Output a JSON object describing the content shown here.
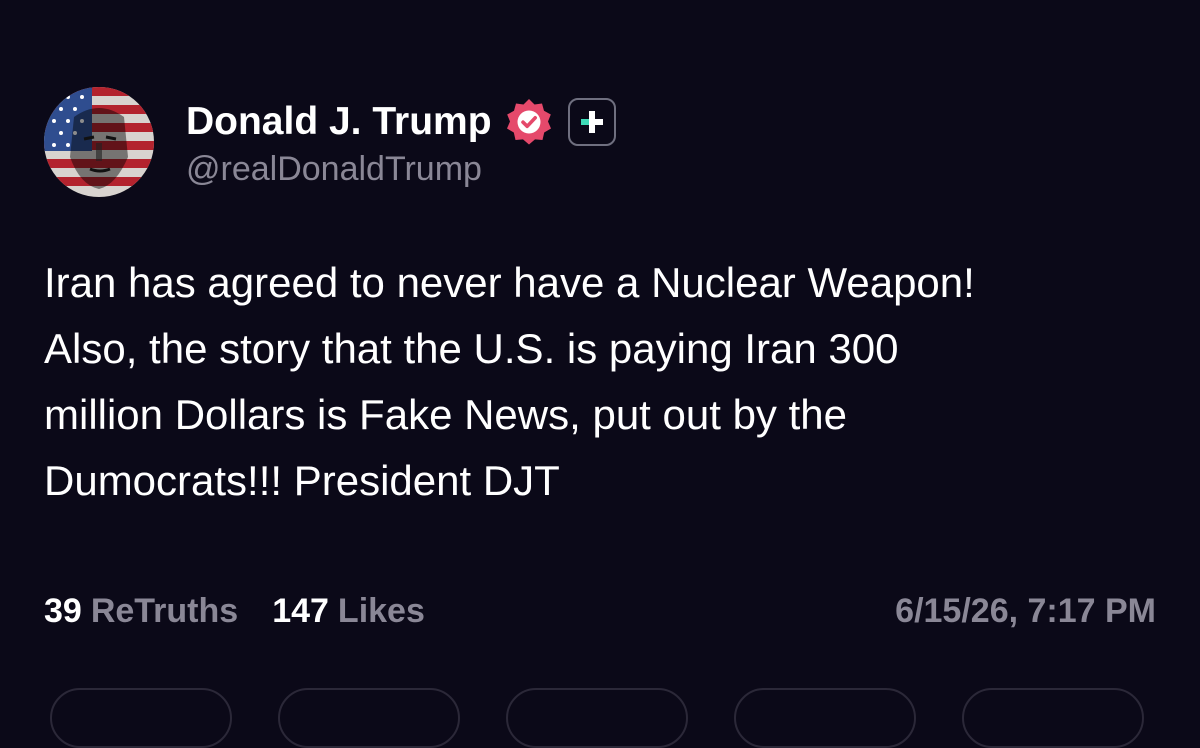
{
  "author": {
    "display_name": "Donald J. Trump",
    "handle": "@realDonaldTrump",
    "verified": true,
    "verified_color": "#e5496b",
    "avatar_icon": "avatar-flag-portrait",
    "plus_icon": "plus-badge-icon"
  },
  "post": {
    "text": "Iran has agreed to never have a Nuclear Weapon!\nAlso, the story that the U.S. is paying Iran 300\nmillion Dollars is Fake News, put out by the\nDumocrats!!! President DJT"
  },
  "stats": {
    "retruths_count": "39",
    "retruths_label": "ReTruths",
    "likes_count": "147",
    "likes_label": "Likes"
  },
  "timestamp": "6/15/26, 7:17 PM",
  "colors": {
    "background": "#0b0918",
    "primary_text": "#ffffff",
    "secondary_text": "#8a8796",
    "accent_green": "#3ddbb7"
  }
}
